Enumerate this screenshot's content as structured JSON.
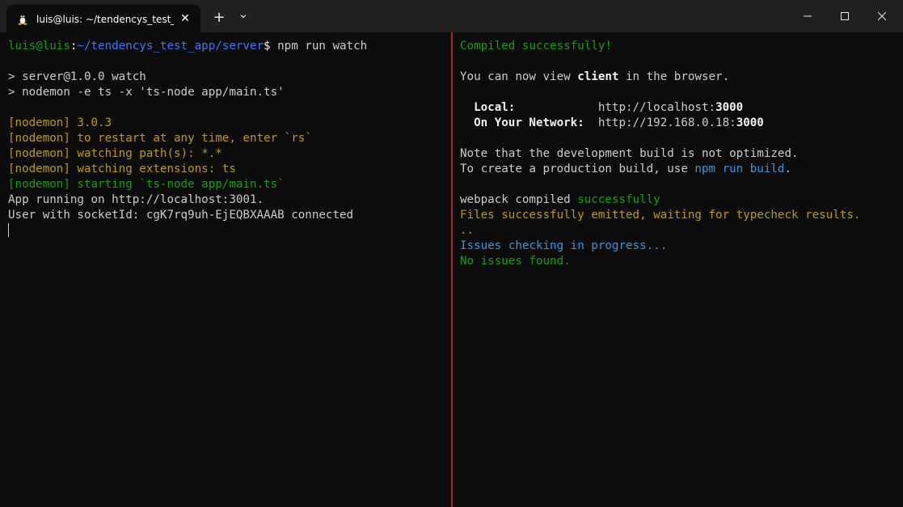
{
  "window": {
    "tab_title": "luis@luis: ~/tendencys_test_a",
    "tab_close": "✕",
    "new_tab": "+",
    "dropdown": "⌄"
  },
  "left_pane": {
    "prompt_user": "luis@luis",
    "prompt_colon": ":",
    "prompt_path": "~/tendencys_test_app/server",
    "prompt_dollar": "$ ",
    "command": "npm run watch",
    "script_line_1": "> server@1.0.0 watch",
    "script_line_2": "> nodemon -e ts -x 'ts-node app/main.ts'",
    "nodemon_1": "[nodemon] 3.0.3",
    "nodemon_2": "[nodemon] to restart at any time, enter `rs`",
    "nodemon_3": "[nodemon] watching path(s): *.*",
    "nodemon_4": "[nodemon] watching extensions: ts",
    "nodemon_5": "[nodemon] starting `ts-node app/main.ts`",
    "app_running": "App running on http://localhost:3001.",
    "socket_line": "User with socketId: cgK7rq9uh-EjEQBXAAAB connected"
  },
  "right_pane": {
    "compiled": "Compiled successfully!",
    "view_prefix": "You can now view ",
    "view_app": "client",
    "view_suffix": " in the browser.",
    "local_label": "  Local:            ",
    "local_url_prefix": "http://localhost:",
    "local_port": "3000",
    "network_label": "  On Your Network:  ",
    "network_url_prefix": "http://192.168.0.18:",
    "network_port": "3000",
    "note_1": "Note that the development build is not optimized.",
    "note_2_prefix": "To create a production build, use ",
    "note_2_cmd": "npm run build",
    "note_2_suffix": ".",
    "webpack_prefix": "webpack compiled ",
    "webpack_status": "successfully",
    "files_emitted": "Files successfully emitted, waiting for typecheck results.",
    "files_emitted_dots": "..",
    "issues_checking": "Issues checking in progress...",
    "no_issues": "No issues found."
  },
  "colors": {
    "background": "#0c0c0c",
    "titlebar": "#202020",
    "divider": "#b02626",
    "green": "#13a10e",
    "yellow": "#c19c00",
    "blue": "#3b78ff",
    "cyan": "#3a96dd",
    "text": "#cccccc"
  }
}
